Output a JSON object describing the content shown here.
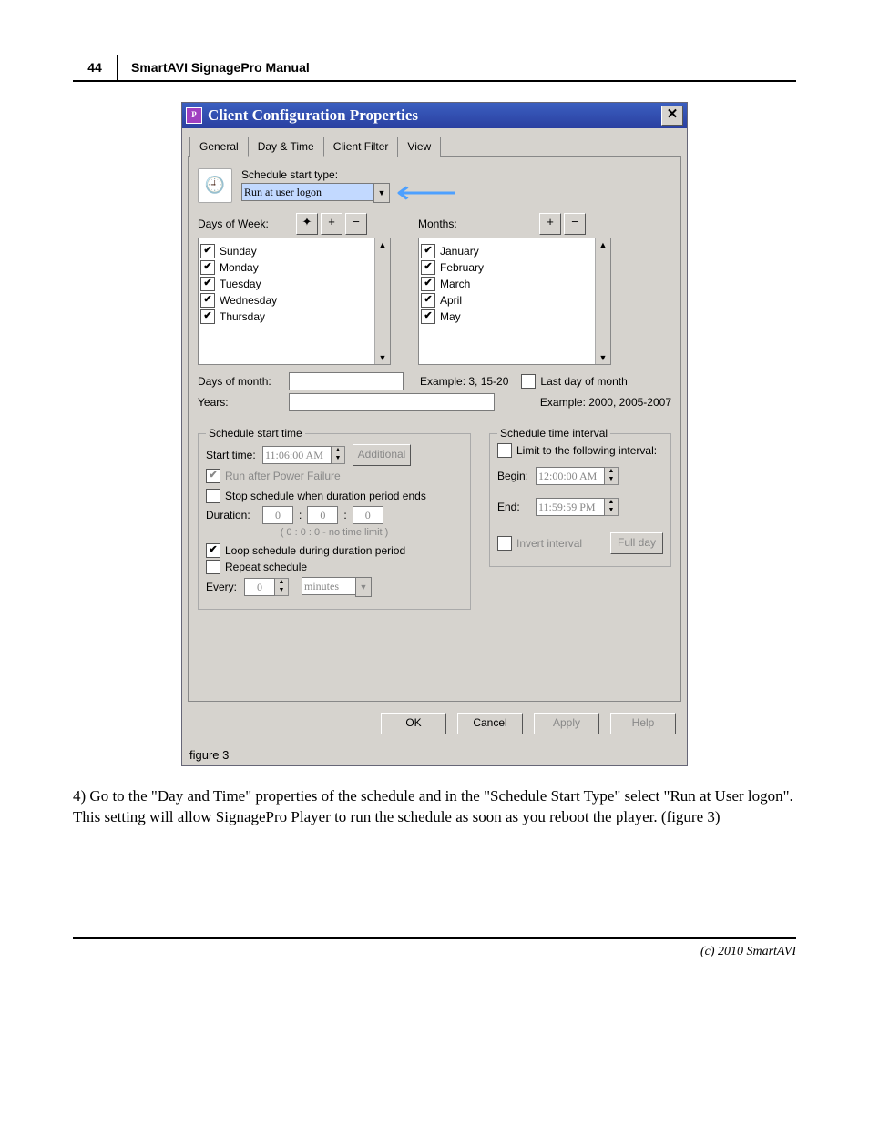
{
  "page": {
    "number": "44",
    "manual": "SmartAVI SignagePro Manual",
    "footer": "(c) 2010 SmartAVI"
  },
  "window": {
    "title": "Client Configuration Properties",
    "figure": "figure 3"
  },
  "tabs": [
    "General",
    "Day & Time",
    "Client Filter",
    "View"
  ],
  "sched": {
    "type_label": "Schedule start type:",
    "type_value": "Run at user logon",
    "days_label": "Days of Week:",
    "months_label": "Months:",
    "days": [
      "Sunday",
      "Monday",
      "Tuesday",
      "Wednesday",
      "Thursday"
    ],
    "months": [
      "January",
      "February",
      "March",
      "April",
      "May"
    ],
    "dom_label": "Days of month:",
    "dom_example": "Example: 3, 15-20",
    "lastday": "Last day of month",
    "years_label": "Years:",
    "years_example": "Example: 2000, 2005-2007"
  },
  "start": {
    "legend": "Schedule start time",
    "time_label": "Start time:",
    "time": "11:06:00 AM",
    "additional": "Additional",
    "runpf": "Run after Power Failure",
    "stopdur": "Stop schedule when duration period ends",
    "duration_label": "Duration:",
    "d1": "0",
    "d2": "0",
    "d3": "0",
    "nolimit": "( 0 : 0 : 0 - no time limit )",
    "loop": "Loop schedule during duration period",
    "repeat": "Repeat schedule",
    "every": "Every:",
    "every_v": "0",
    "every_unit": "minutes"
  },
  "interval": {
    "legend": "Schedule time interval",
    "limit": "Limit to the following interval:",
    "begin_label": "Begin:",
    "begin": "12:00:00 AM",
    "end_label": "End:",
    "end": "11:59:59 PM",
    "invert": "Invert interval",
    "fullday": "Full day"
  },
  "buttons": {
    "ok": "OK",
    "cancel": "Cancel",
    "apply": "Apply",
    "help": "Help"
  },
  "caption": "4) Go to the \"Day and Time\" properties of the schedule and in the \"Schedule Start Type\" select \"Run at User logon\". This setting will allow SignagePro Player to run the schedule as soon as you reboot the player. (figure 3)"
}
